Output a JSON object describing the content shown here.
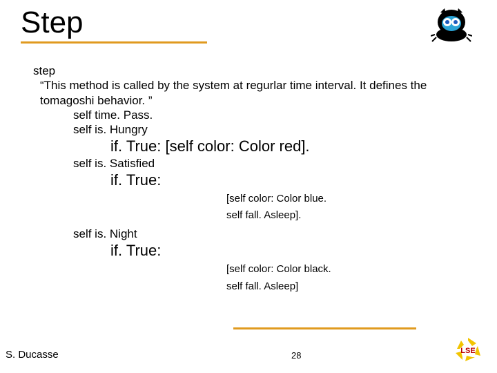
{
  "title": "Step",
  "body": {
    "line1": "step",
    "comment": "“This method is called by the system at regurlar time interval. It defines the tomagoshi behavior. ”",
    "l_timepass": "self time. Pass.",
    "l_ishungry": "self is. Hungry",
    "if1": "if. True: [self color: Color red].",
    "l_issatisfied": "self is. Satisfied",
    "if2": "if. True:",
    "block2a": "[self color: Color blue.",
    "block2b": "self fall. Asleep].",
    "l_isnight": "self is. Night",
    "if3": "if. True:",
    "block3a": "[self color: Color black.",
    "block3b": "self fall. Asleep]"
  },
  "footer": {
    "author": "S. Ducasse",
    "page": "28"
  },
  "icons": {
    "mascot": "creature-mascot-icon",
    "logo": "lse-recycle-logo-icon"
  }
}
